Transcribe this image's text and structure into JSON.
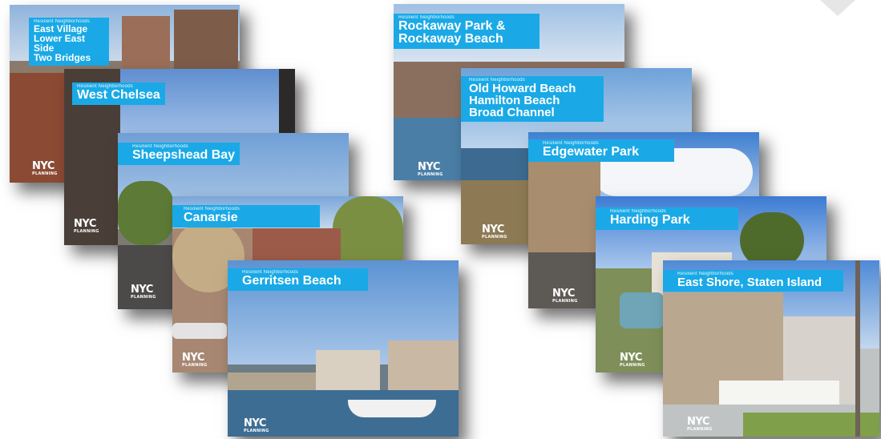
{
  "card_subtitle": "Resilient Neighborhoods",
  "logo": {
    "text": "NYC",
    "sub": "PLANNING"
  },
  "cards": {
    "east_village": {
      "lines": [
        "East Village",
        "Lower East Side",
        "Two Bridges"
      ]
    },
    "west_chelsea": {
      "title": "West Chelsea"
    },
    "sheepshead": {
      "title": "Sheepshead Bay"
    },
    "canarsie": {
      "title": "Canarsie"
    },
    "gerritsen": {
      "title": "Gerritsen Beach"
    },
    "rockaway": {
      "lines": [
        "Rockaway Park &",
        "Rockaway Beach"
      ]
    },
    "howard": {
      "lines": [
        "Old Howard Beach",
        "Hamilton Beach",
        "Broad Channel"
      ]
    },
    "edgewater": {
      "title": "Edgewater Park"
    },
    "harding": {
      "title": "Harding Park"
    },
    "east_shore": {
      "title": "East Shore, Staten Island"
    }
  },
  "colors": {
    "banner": "#1aa9e6",
    "sky": "#6f9fd6",
    "water": "#3e6d93"
  }
}
